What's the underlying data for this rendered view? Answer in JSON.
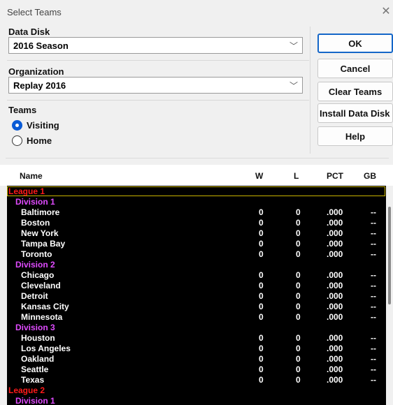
{
  "window": {
    "title": "Select Teams"
  },
  "data_disk": {
    "label": "Data Disk",
    "value": "2016  Season"
  },
  "organization": {
    "label": "Organization",
    "value": "Replay 2016"
  },
  "teams": {
    "label": "Teams",
    "options": [
      {
        "label": "Visiting",
        "selected": true
      },
      {
        "label": "Home",
        "selected": false
      }
    ]
  },
  "buttons": {
    "ok": "OK",
    "cancel": "Cancel",
    "clear": "Clear Teams",
    "install": "Install Data Disk",
    "help": "Help"
  },
  "columns": {
    "name": "Name",
    "w": "W",
    "l": "L",
    "pct": "PCT",
    "gb": "GB"
  },
  "standings": [
    {
      "type": "league",
      "name": "League 1"
    },
    {
      "type": "division",
      "name": "Division 1"
    },
    {
      "type": "team",
      "name": "Baltimore",
      "w": "0",
      "l": "0",
      "pct": ".000",
      "gb": "--"
    },
    {
      "type": "team",
      "name": "Boston",
      "w": "0",
      "l": "0",
      "pct": ".000",
      "gb": "--"
    },
    {
      "type": "team",
      "name": "New York",
      "w": "0",
      "l": "0",
      "pct": ".000",
      "gb": "--"
    },
    {
      "type": "team",
      "name": "Tampa Bay",
      "w": "0",
      "l": "0",
      "pct": ".000",
      "gb": "--"
    },
    {
      "type": "team",
      "name": "Toronto",
      "w": "0",
      "l": "0",
      "pct": ".000",
      "gb": "--"
    },
    {
      "type": "division",
      "name": "Division 2"
    },
    {
      "type": "team",
      "name": "Chicago",
      "w": "0",
      "l": "0",
      "pct": ".000",
      "gb": "--"
    },
    {
      "type": "team",
      "name": "Cleveland",
      "w": "0",
      "l": "0",
      "pct": ".000",
      "gb": "--"
    },
    {
      "type": "team",
      "name": "Detroit",
      "w": "0",
      "l": "0",
      "pct": ".000",
      "gb": "--"
    },
    {
      "type": "team",
      "name": "Kansas City",
      "w": "0",
      "l": "0",
      "pct": ".000",
      "gb": "--"
    },
    {
      "type": "team",
      "name": "Minnesota",
      "w": "0",
      "l": "0",
      "pct": ".000",
      "gb": "--"
    },
    {
      "type": "division",
      "name": "Division 3"
    },
    {
      "type": "team",
      "name": "Houston",
      "w": "0",
      "l": "0",
      "pct": ".000",
      "gb": "--"
    },
    {
      "type": "team",
      "name": "Los Angeles",
      "w": "0",
      "l": "0",
      "pct": ".000",
      "gb": "--"
    },
    {
      "type": "team",
      "name": "Oakland",
      "w": "0",
      "l": "0",
      "pct": ".000",
      "gb": "--"
    },
    {
      "type": "team",
      "name": "Seattle",
      "w": "0",
      "l": "0",
      "pct": ".000",
      "gb": "--"
    },
    {
      "type": "team",
      "name": "Texas",
      "w": "0",
      "l": "0",
      "pct": ".000",
      "gb": "--"
    },
    {
      "type": "league",
      "name": "League 2"
    },
    {
      "type": "division",
      "name": "Division 1"
    }
  ]
}
